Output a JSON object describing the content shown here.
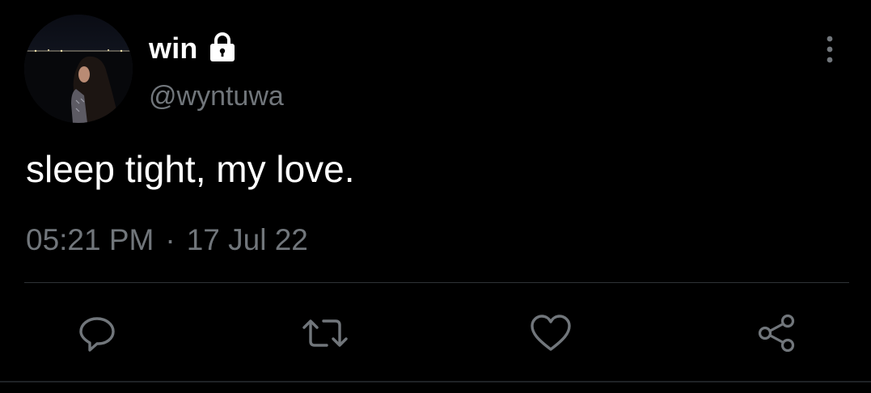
{
  "tweet": {
    "author": {
      "display_name": "win",
      "handle": "@wyntuwa",
      "protected": true,
      "avatar": "profile-photo"
    },
    "text": "sleep tight, my love.",
    "time": "05:21 PM",
    "separator": "·",
    "date": "17 Jul 22"
  },
  "actions": [
    {
      "name": "reply",
      "icon": "speech-bubble-icon"
    },
    {
      "name": "retweet",
      "icon": "retweet-arrows-icon"
    },
    {
      "name": "like",
      "icon": "heart-icon"
    },
    {
      "name": "share",
      "icon": "share-nodes-icon"
    }
  ],
  "colors": {
    "background": "#000000",
    "primary_text": "#ffffff",
    "secondary_text": "#71767b",
    "divider": "#2f3336"
  }
}
